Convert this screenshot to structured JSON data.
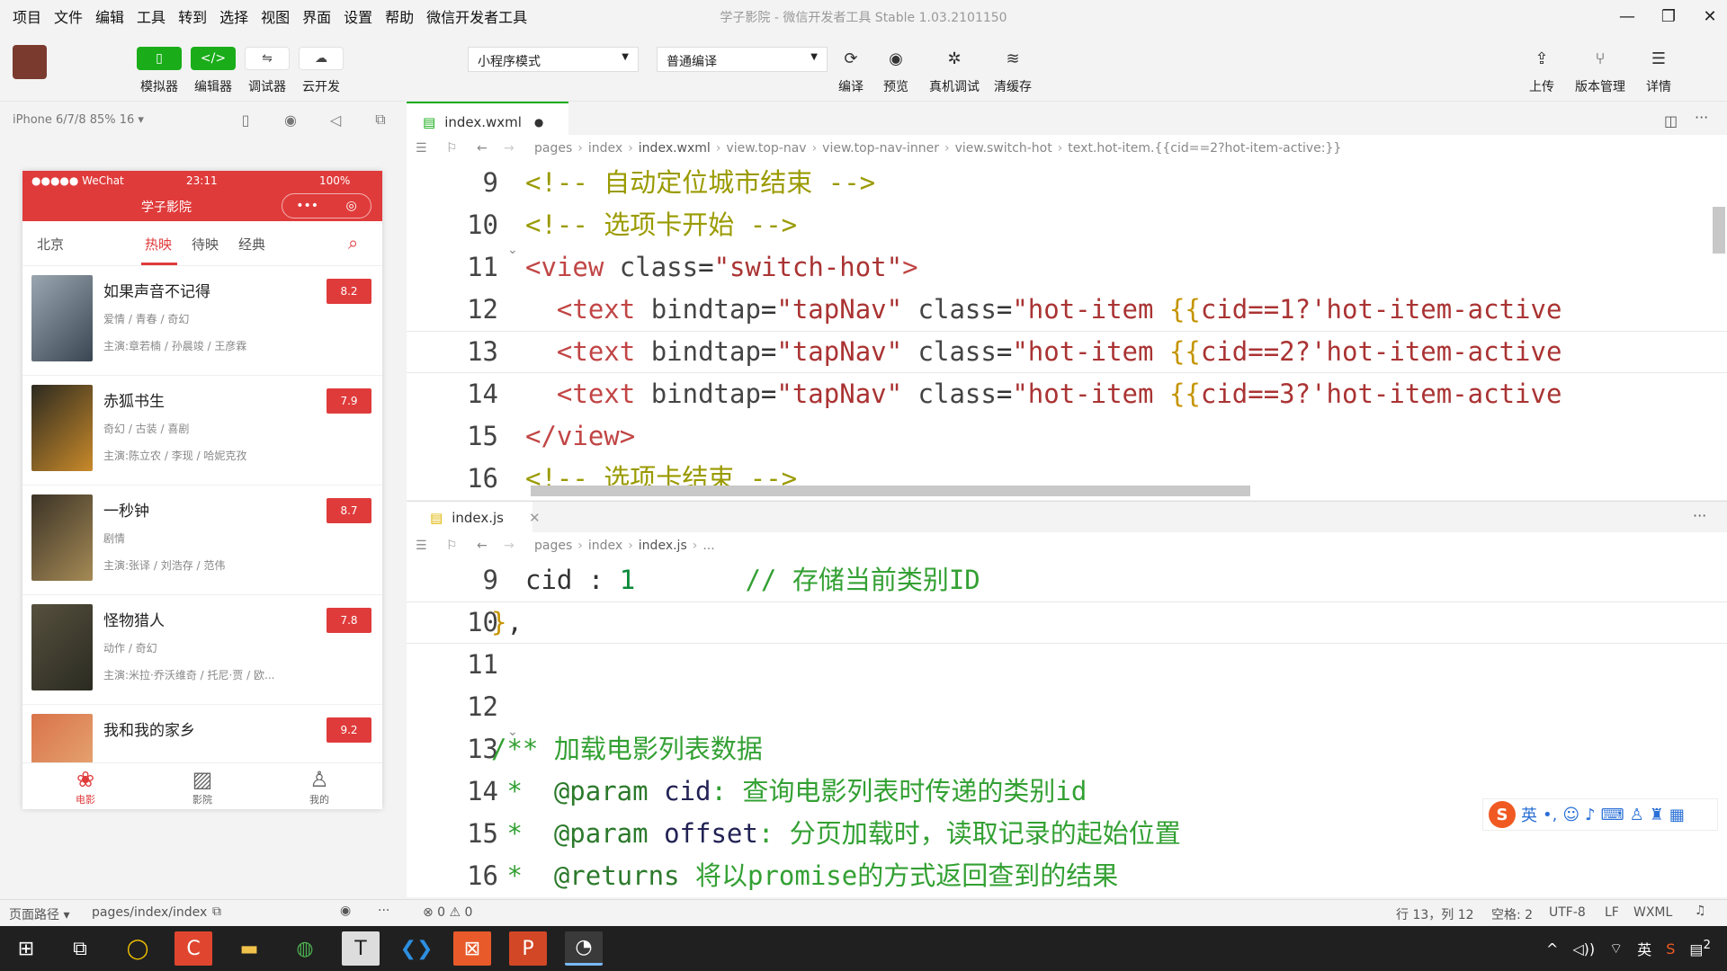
{
  "menu": [
    "项目",
    "文件",
    "编辑",
    "工具",
    "转到",
    "选择",
    "视图",
    "界面",
    "设置",
    "帮助",
    "微信开发者工具"
  ],
  "window_title": "学子影院 - 微信开发者工具 Stable 1.03.2101150",
  "toolbar": {
    "simulator": "模拟器",
    "editor": "编辑器",
    "debugger": "调试器",
    "cloud": "云开发",
    "mode_select": "小程序模式",
    "compile_select": "普通编译",
    "compile": "编译",
    "preview": "预览",
    "remote_debug": "真机调试",
    "clear_cache": "清缓存",
    "upload": "上传",
    "version": "版本管理",
    "details": "详情"
  },
  "simulator": {
    "device": "iPhone 6/7/8 85% 16 ▾",
    "status_left": "●●●●● WeChat",
    "status_time": "23:11",
    "status_right": "100%",
    "nav_title": "学子影院",
    "city": "北京",
    "tabs": [
      "热映",
      "待映",
      "经典"
    ],
    "movies": [
      {
        "title": "如果声音不记得",
        "genre": "爱情 / 青春 / 奇幻",
        "cast": "主演:章若楠 / 孙晨竣 / 王彦霖",
        "score": "8.2"
      },
      {
        "title": "赤狐书生",
        "genre": "奇幻 / 古装 / 喜剧",
        "cast": "主演:陈立农 / 李现 / 哈妮克孜",
        "score": "7.9"
      },
      {
        "title": "一秒钟",
        "genre": "剧情",
        "cast": "主演:张译 / 刘浩存 / 范伟",
        "score": "8.7"
      },
      {
        "title": "怪物猎人",
        "genre": "动作 / 奇幻",
        "cast": "主演:米拉·乔沃维奇 / 托尼·贾 / 欧...",
        "score": "7.8"
      },
      {
        "title": "我和我的家乡",
        "genre": "",
        "cast": "",
        "score": "9.2"
      }
    ],
    "tabbar": [
      "电影",
      "影院",
      "我的"
    ]
  },
  "editor_top": {
    "tab": "index.wxml",
    "breadcrumb": [
      "pages",
      "index",
      "index.wxml",
      "view.top-nav",
      "view.top-nav-inner",
      "view.switch-hot",
      "text.hot-item.{{cid==2?hot-item-active:}}"
    ],
    "lines": [
      "9",
      "10",
      "11",
      "12",
      "13",
      "14",
      "15",
      "16"
    ]
  },
  "editor_bottom": {
    "tab": "index.js",
    "breadcrumb": [
      "pages",
      "index",
      "index.js",
      "..."
    ],
    "lines": [
      "9",
      "10",
      "11",
      "12",
      "13",
      "14",
      "15",
      "16"
    ]
  },
  "statusbar": {
    "path_label": "页面路径 ▾",
    "path": "pages/index/index",
    "problems": "⊗ 0 ⚠ 0",
    "position": "行 13，列 12",
    "spaces": "空格: 2",
    "encoding": "UTF-8",
    "eol": "LF",
    "lang": "WXML"
  },
  "ime": {
    "lang": "英"
  },
  "tray": {
    "lang": "英",
    "notif": "2"
  }
}
